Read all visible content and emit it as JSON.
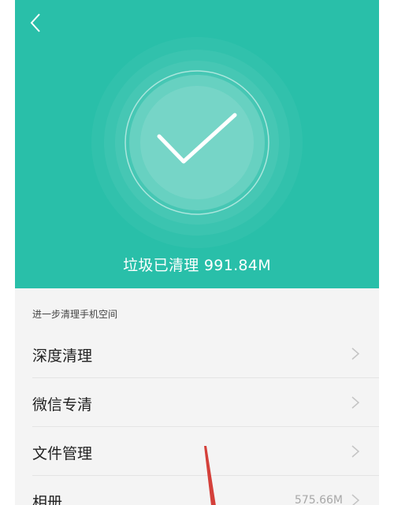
{
  "header": {
    "back_icon": "chevron-left-icon",
    "status_icon": "check-icon",
    "cleaned_text": "垃圾已清理 991.84M"
  },
  "section": {
    "caption": "进一步清理手机空间"
  },
  "items": [
    {
      "label": "深度清理",
      "value": "",
      "icon": "chevron-right-icon"
    },
    {
      "label": "微信专清",
      "value": "",
      "icon": "chevron-right-icon"
    },
    {
      "label": "文件管理",
      "value": "",
      "icon": "chevron-right-icon"
    },
    {
      "label": "相册",
      "value": "575.66M",
      "icon": "chevron-right-icon"
    }
  ],
  "colors": {
    "accent": "#29bfa9",
    "annotation": "#d4403a"
  }
}
